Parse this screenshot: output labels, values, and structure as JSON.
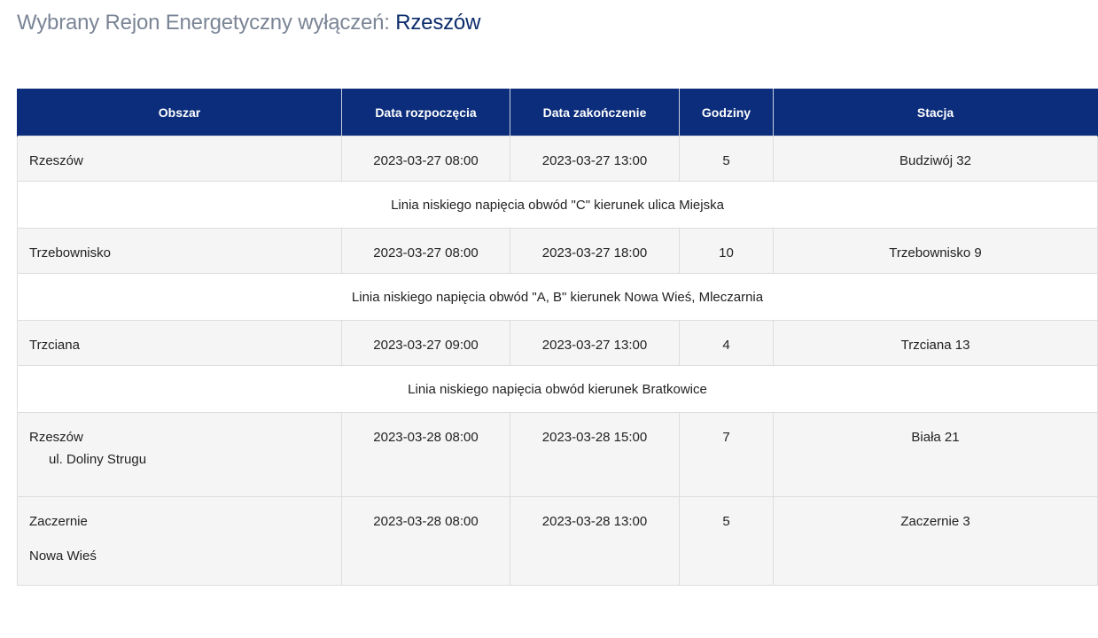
{
  "heading": {
    "prefix": "Wybrany Rejon Energetyczny wyłączeń:",
    "region": "Rzeszów"
  },
  "table": {
    "columns": [
      "Obszar",
      "Data rozpoczęcia",
      "Data zakończenie",
      "Godziny",
      "Stacja"
    ],
    "rows": [
      {
        "area": "Rzeszów",
        "start": "2023-03-27 08:00",
        "end": "2023-03-27 13:00",
        "hours": "5",
        "station": "Budziwój 32",
        "description": "Linia niskiego napięcia obwód \"C\" kierunek ulica Miejska"
      },
      {
        "area": "Trzebownisko",
        "start": "2023-03-27 08:00",
        "end": "2023-03-27 18:00",
        "hours": "10",
        "station": "Trzebownisko 9",
        "description": "Linia niskiego napięcia obwód \"A, B\" kierunek Nowa Wieś, Mleczarnia"
      },
      {
        "area": "Trzciana",
        "start": "2023-03-27 09:00",
        "end": "2023-03-27 13:00",
        "hours": "4",
        "station": "Trzciana 13",
        "description": "Linia niskiego napięcia obwód kierunek Bratkowice"
      },
      {
        "area": "Rzeszów",
        "area_detail": "ul. Doliny Strugu",
        "start": "2023-03-28 08:00",
        "end": "2023-03-28 15:00",
        "hours": "7",
        "station": "Biała 21"
      },
      {
        "area": "Zaczernie",
        "area_detail": "Nowa Wieś",
        "start": "2023-03-28 08:00",
        "end": "2023-03-28 13:00",
        "hours": "5",
        "station": "Zaczernie 3"
      }
    ]
  },
  "colors": {
    "header_bg": "#0b2d7b",
    "heading_accent": "#0b2d6b",
    "row_bg": "#f5f5f5"
  }
}
